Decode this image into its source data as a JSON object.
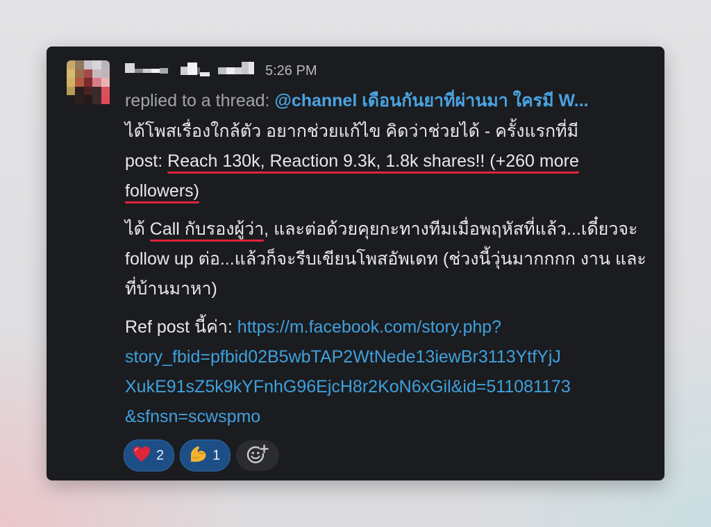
{
  "message": {
    "timestamp": "5:26 PM",
    "thread_prefix": "replied to a thread:",
    "thread_link": "@channel เดือนกันยาที่ผ่านมา ใครมี W...",
    "para1": {
      "line1": "ได้โพสเรื่องใกล้ตัว อยากช่วยแก้ไข คิดว่าช่วยได้ - ครั้งแรกที่มี",
      "lead": "post: ",
      "underlined_a": "Reach 130k, Reaction 9.3k, 1.8k shares!! (+260 more",
      "underlined_b": "followers)"
    },
    "para2": {
      "lead": "ได้ ",
      "underlined": "Call กับรองผู้ว่า",
      "rest": ", และต่อด้วยคุยกะทางทีมเมื่อพฤหัสที่แล้ว...เดี๋ยวจะ follow up ต่อ...แล้วก็จะรีบเขียนโพสอัพเดท (ช่วงนี้วุ่นมากกกก งาน และที่บ้านมาหา)"
    },
    "para3": {
      "lead": "Ref post นี้ค่า: ",
      "link_line1": "https://m.facebook.com/story.php?",
      "link_line2": "story_fbid=pfbid02B5wbTAP2WtNede13iewBr3113YtfYjJ",
      "link_line3": "XukE91sZ5k9kYFnhG96EjcH8r2KoN6xGil&id=511081173",
      "link_line4": "&sfnsn=scwspmo"
    }
  },
  "reactions": [
    {
      "emoji": "❤️",
      "icon": "red-heart-icon",
      "count": "2"
    },
    {
      "emoji": "💪",
      "icon": "flexed-biceps-icon",
      "count": "1"
    }
  ],
  "colors": {
    "card_bg": "#1b1c20",
    "link": "#3fa1dd",
    "underline_red": "#e0243a",
    "reaction_bg": "#1d4f86"
  }
}
